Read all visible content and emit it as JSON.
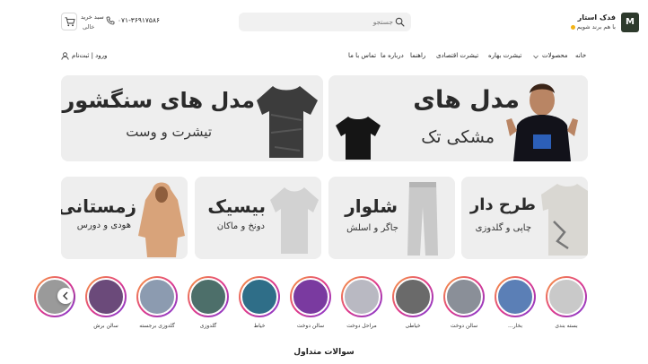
{
  "header": {
    "logo_mark": "M",
    "brand_name": "فدک استار",
    "brand_tagline": "با هم برند شویم",
    "search_placeholder": "جستجو",
    "phone": "۰۷۱-۳۶۹۱۷۵۸۶",
    "cart_label": "سبد خرید",
    "cart_value": "خالی"
  },
  "nav": {
    "items": [
      "خانه",
      "محصولات",
      "تیشرت بهاره",
      "تیشرت اقتصادی",
      "راهنما",
      "درباره ما",
      "تماس با ما"
    ],
    "login": "ورود | ثبت‌نام"
  },
  "banners": [
    {
      "title": "مدل های",
      "subtitle": "مشکی تک"
    },
    {
      "title": "مدل های سنگشور",
      "subtitle": "تیشرت و وست"
    }
  ],
  "categories": [
    {
      "title": "طرح دار",
      "subtitle": "چاپی و گلدوزی"
    },
    {
      "title": "شلوار",
      "subtitle": "جاگر و اسلش"
    },
    {
      "title": "بیسیک",
      "subtitle": "دونخ و ماکان"
    },
    {
      "title": "زمستانی",
      "subtitle": "هودی و دورس"
    }
  ],
  "stories": [
    {
      "label": "بسته بندی",
      "color": "#c9c9c9"
    },
    {
      "label": "بخار...",
      "color": "#5b7fb6"
    },
    {
      "label": "سالن دوخت",
      "color": "#8a8f98"
    },
    {
      "label": "خیاطی",
      "color": "#6a6a6a"
    },
    {
      "label": "مراحل دوخت",
      "color": "#b9b9c2"
    },
    {
      "label": "سالن دوخت",
      "color": "#7a3aa0"
    },
    {
      "label": "خیاط",
      "color": "#2f6e88"
    },
    {
      "label": "گلدوزی",
      "color": "#4d6f6a"
    },
    {
      "label": "گلدوزی برجسته",
      "color": "#8c9bb0"
    },
    {
      "label": "سالن برش",
      "color": "#6b4a7a"
    },
    {
      "label": "",
      "color": "#9a9a9a"
    }
  ],
  "faq_title": "سوالات متداول"
}
